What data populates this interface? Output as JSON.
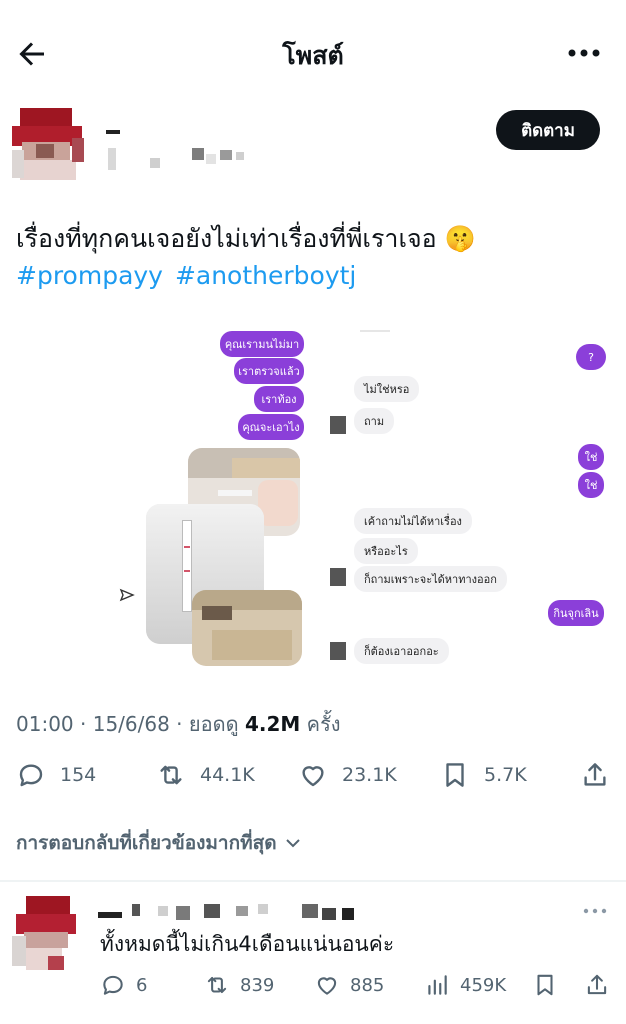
{
  "header": {
    "title": "โพสต์",
    "back_icon": "arrow-left-icon",
    "more_icon": "more-horizontal-icon"
  },
  "author": {
    "follow_label": "ติดตาม"
  },
  "tweet": {
    "text": "เรื่องที่ทุกคนเจอยังไม่เท่าเรื่องที่พี่เราเจอ 🤫",
    "hashtags": [
      "#prompayy",
      "#anotherboytj"
    ],
    "media": {
      "chat": {
        "right_top": [
          "คุณเรามนไม่มา",
          "เราตรวจแล้ว",
          "เราท้อง",
          "คุณจะเอาไง"
        ],
        "left_1": [
          "ไม่ใช่หรอ",
          "ถาม"
        ],
        "right_q": "?",
        "right_yes": [
          "ใช่",
          "ใช่"
        ],
        "left_2": [
          "เค้าถามไม่ได้หาเรื่อง",
          "หรืออะไร",
          "ก็ถามเพราะจะได้หาทางออก"
        ],
        "right_last": "กินจุกเลิน",
        "left_3": "ก็ต้องเอาออกอะ"
      }
    },
    "meta": {
      "time": "01:00",
      "sep1": " · ",
      "date": "15/6/68",
      "sep2": " · ",
      "views_prefix": "ยอดดู ",
      "views": "4.2M",
      "views_suffix": " ครั้ง"
    },
    "actions": {
      "replies": "154",
      "reposts": "44.1K",
      "likes": "23.1K",
      "bookmarks": "5.7K"
    }
  },
  "replies_filter": "การตอบกลับที่เกี่ยวข้องมากที่สุด",
  "reply": {
    "text": "ทั้งหมดนี้ไม่เกิน4เดือนแน่นอนค่ะ",
    "actions": {
      "replies": "6",
      "reposts": "839",
      "likes": "885",
      "views": "459K"
    }
  },
  "colors": {
    "accent": "#1d9bf0",
    "chat_purple": "#8b3fd9",
    "text_secondary": "#536471"
  }
}
